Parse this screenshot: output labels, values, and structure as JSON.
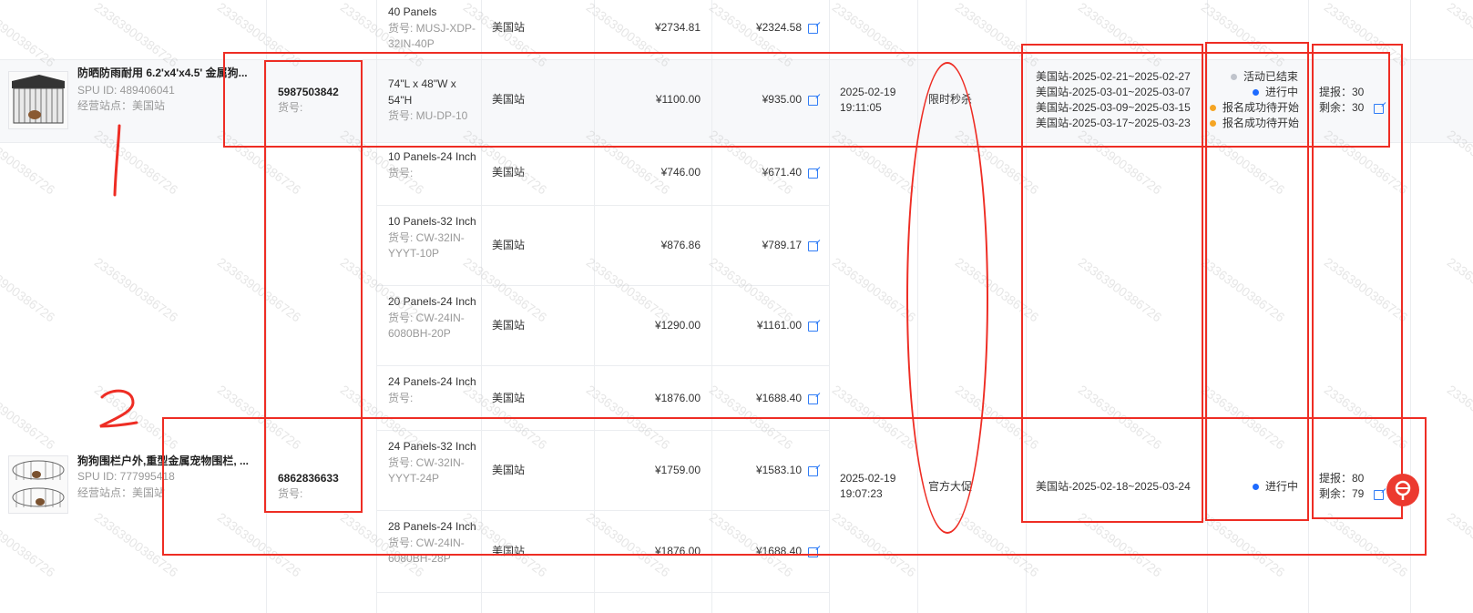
{
  "products": [
    {
      "title": "防晒防雨耐用 6.2'x4'x4.5' 金属狗...",
      "spu": "SPU ID: 489406041",
      "site": "经营站点：美国站",
      "icon": "dog-kennel-roof-image"
    },
    {
      "title": "狗狗围栏户外,重型金属宠物围栏, ...",
      "spu": "SPU ID: 777995418",
      "site": "经营站点：美国站",
      "icon": "dog-fence-panels-image"
    }
  ],
  "skc": [
    {
      "id": "5987503842",
      "code": "货号:"
    },
    {
      "id": "6862836633",
      "code": "货号:"
    }
  ],
  "rows": [
    {
      "sku": "40 Panels 货号: MUSJ-XDP-32IN-40P",
      "site": "美国站",
      "price": "¥2734.81",
      "promo": "¥2324.58"
    },
    {
      "sku": "74\"L x 48\"W x 54\"H 货号: MU-DP-10",
      "site": "美国站",
      "price": "¥1100.00",
      "promo": "¥935.00"
    },
    {
      "sku": "10 Panels-24 Inch 货号:",
      "site": "美国站",
      "price": "¥746.00",
      "promo": "¥671.40"
    },
    {
      "sku": "10 Panels-32 Inch 货号: CW-32IN-YYYT-10P",
      "site": "美国站",
      "price": "¥876.86",
      "promo": "¥789.17"
    },
    {
      "sku": "20 Panels-24 Inch 货号: CW-24IN-6080BH-20P",
      "site": "美国站",
      "price": "¥1290.00",
      "promo": "¥1161.00"
    },
    {
      "sku": "24 Panels-24 Inch 货号:",
      "site": "美国站",
      "price": "¥1876.00",
      "promo": "¥1688.40"
    },
    {
      "sku": "24 Panels-32 Inch 货号: CW-32IN-YYYT-24P",
      "site": "美国站",
      "price": "¥1759.00",
      "promo": "¥1583.10"
    },
    {
      "sku": "28 Panels-24 Inch 货号: CW-24IN-6080BH-28P",
      "site": "美国站",
      "price": "¥1876.00",
      "promo": "¥1688.40"
    }
  ],
  "activities": [
    {
      "created": "2025-02-19 19:11:05",
      "type": "限时秒杀",
      "periods": [
        "美国站-2025-02-21~2025-02-27",
        "美国站-2025-03-01~2025-03-07",
        "美国站-2025-03-09~2025-03-15",
        "美国站-2025-03-17~2025-03-23"
      ],
      "statuses": [
        {
          "label": "活动已结束",
          "color": "#c0c4cc"
        },
        {
          "label": "进行中",
          "color": "#1f6bff"
        },
        {
          "label": "报名成功待开始",
          "color": "#f5a524"
        },
        {
          "label": "报名成功待开始",
          "color": "#f5a524"
        }
      ],
      "reported": "提报：30",
      "remaining": "剩余：30"
    },
    {
      "created": "2025-02-19 19:07:23",
      "type": "官方大促",
      "periods": [
        "美国站-2025-02-18~2025-03-24"
      ],
      "statuses": [
        {
          "label": "进行中",
          "color": "#1f6bff"
        }
      ],
      "reported": "提报：80",
      "remaining": "剩余：79"
    }
  ],
  "annotations": {
    "mark1": "1",
    "mark2": "2"
  },
  "watermark": "233639003867​26",
  "accent_color": "#2f7cf6",
  "annotation_color": "#ee2d24",
  "help_icon": "help-icon"
}
